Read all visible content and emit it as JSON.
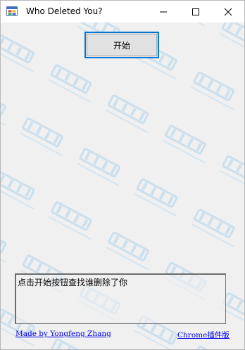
{
  "window": {
    "title": "Who Deleted You?",
    "icon": "app-window-icon",
    "controls": {
      "minimize": "minimize-icon",
      "maximize": "maximize-icon",
      "close": "close-icon"
    }
  },
  "main": {
    "start_button_label": "开始",
    "output_text": "点击开始按钮查找谁删除了你"
  },
  "footer": {
    "author_link": "Made by Yongfeng Zhang",
    "chrome_link": "Chrome插件版"
  },
  "colors": {
    "accent": "#0078d7",
    "link": "#0000ee",
    "window_bg": "#f0f0f0"
  }
}
